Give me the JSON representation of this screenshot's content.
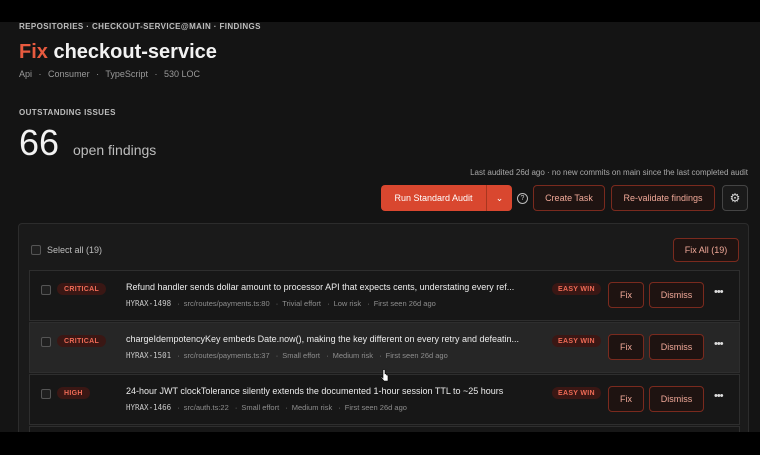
{
  "breadcrumb": "REPOSITORIES · CHECKOUT-SERVICE@MAIN · FINDINGS",
  "title": {
    "prefix": "Fix",
    "name": "checkout-service"
  },
  "meta": [
    "Api",
    "·",
    "Consumer",
    "·",
    "TypeScript",
    "·",
    "530 LOC"
  ],
  "issues": {
    "label": "OUTSTANDING ISSUES",
    "count": "66",
    "count_label": "open findings"
  },
  "audit_note": "Last audited 26d ago · no new commits on main since the last completed audit",
  "toolbar": {
    "run_audit": "Run Standard Audit",
    "dropdown": "⌄",
    "help": "?",
    "create_task": "Create Task",
    "revalidate": "Re-validate findings",
    "settings": "⚙"
  },
  "list": {
    "select_all": "Select all (19)",
    "fix_all": "Fix All (19)",
    "rows": [
      {
        "severity": "CRITICAL",
        "title": "Refund handler sends dollar amount to processor API that expects cents, understating every ref...",
        "id": "HYRAX-1498",
        "path": "src/routes/payments.ts:80",
        "effort": "Trivial effort",
        "risk": "Low risk",
        "seen": "First seen 26d ago",
        "tag": "EASY WIN",
        "fix": "Fix",
        "dismiss": "Dismiss",
        "more": "•••"
      },
      {
        "severity": "CRITICAL",
        "title": "chargeIdempotencyKey embeds Date.now(), making the key different on every retry and defeatin...",
        "id": "HYRAX-1501",
        "path": "src/routes/payments.ts:37",
        "effort": "Small effort",
        "risk": "Medium risk",
        "seen": "First seen 26d ago",
        "tag": "EASY WIN",
        "fix": "Fix",
        "dismiss": "Dismiss",
        "more": "•••"
      },
      {
        "severity": "HIGH",
        "title": "24-hour JWT clockTolerance silently extends the documented 1-hour session TTL to ~25 hours",
        "id": "HYRAX-1466",
        "path": "src/auth.ts:22",
        "effort": "Small effort",
        "risk": "Medium risk",
        "seen": "First seen 26d ago",
        "tag": "EASY WIN",
        "fix": "Fix",
        "dismiss": "Dismiss",
        "more": "•••"
      }
    ]
  },
  "colors": {
    "accent": "#d9472f",
    "severity_text": "#ef6b56",
    "background": "#141414"
  }
}
